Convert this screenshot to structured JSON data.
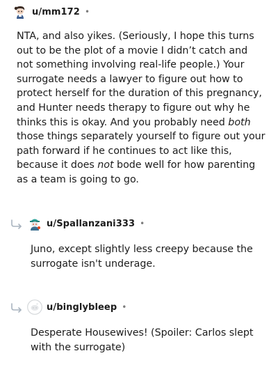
{
  "comments": [
    {
      "username": "u/mm172",
      "separator": "•",
      "avatar_icon": "snoo-avatar-icon",
      "body": {
        "p1": "NTA, and also yikes. (Seriously, I hope this turns out to be the plot of a movie I didn’t catch and not something involving real-life people.) Your surrogate needs a lawyer to figure out how to protect herself for the duration of this pregnancy, and Hunter needs therapy to figure out why he thinks this is okay. And you probably need ",
        "em1": "both",
        "p2": " those things separately yourself to figure out your path forward if he continues to act like this, because it does ",
        "em2": "not",
        "p3": " bode well for how parenting as a team is going to go."
      }
    },
    {
      "username": "u/Spallanzani333",
      "separator": "•",
      "avatar_icon": "snoo-avatar-icon",
      "body": "Juno, except slightly less creepy because the surrogate isn't underage."
    },
    {
      "username": "u/binglybleep",
      "separator": "•",
      "avatar_icon": "default-avatar-icon",
      "body": "Desperate Housewives! (Spoiler: Carlos slept with the surrogate)"
    }
  ],
  "colors": {
    "text": "#1c1c1c",
    "meta": "#7c7c7c",
    "reply_arrow": "#a9b4bf"
  }
}
